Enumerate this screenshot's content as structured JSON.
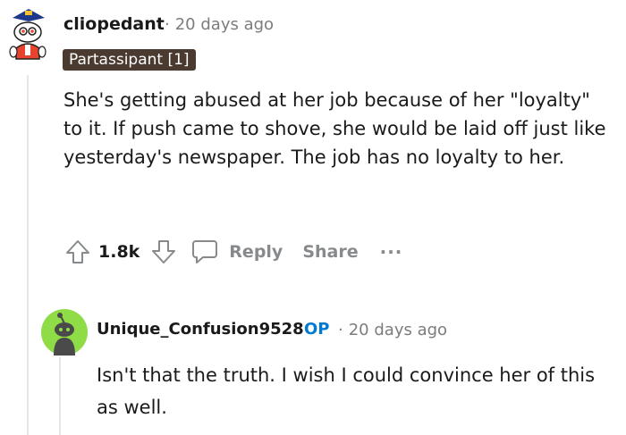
{
  "comment": {
    "username": "cliopedant",
    "separator": "·",
    "time": "20 days ago",
    "flair": "Partassipant [1]",
    "body": "She's getting abused at her job because of her \"loyalty\" to it. If push came to shove, she would be laid off just like yesterday's newspaper. The job has no loyalty to her.",
    "score": "1.8k",
    "actions": {
      "reply": "Reply",
      "share": "Share",
      "more": "···"
    }
  },
  "reply": {
    "username": "Unique_Confusion9528",
    "op_badge": "OP",
    "separator": "·",
    "time": "20 days ago",
    "body": "Isn't that the truth. I wish I could convince her of this as well."
  },
  "colors": {
    "op_blue": "#0079d3",
    "flair_bg": "#4a3a2f",
    "muted": "#878a8c",
    "avatar2_bg": "#8fdc46"
  },
  "icons": [
    "upvote-icon",
    "downvote-icon",
    "comment-icon",
    "more-icon"
  ]
}
